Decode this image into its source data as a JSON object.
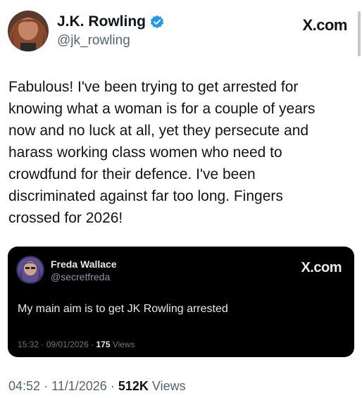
{
  "header": {
    "display_name": "J.K. Rowling",
    "handle": "@jk_rowling",
    "brand": "X.com",
    "verified_icon": "verified-badge-icon",
    "avatar_icon": "profile-photo"
  },
  "tweet": {
    "text": "Fabulous! I've been trying to get arrested for\nknowing what a woman is for a couple of years\nnow and no luck at all, yet they persecute and\nharass working class women who need to\ncrowdfund for their defence. I've been\ndiscriminated against far too long. Fingers\ncrossed for 2026!",
    "time": "04:52",
    "date": "11/1/2026",
    "views_count": "512K",
    "views_label": "Views",
    "separator": "·"
  },
  "quote": {
    "display_name": "Freda Wallace",
    "handle": "@secretfreda",
    "brand": "X.com",
    "text": "My main aim is to get JK Rowling arrested",
    "time": "15:32",
    "date": "09/01/2026",
    "views_count": "175",
    "views_label": "Views",
    "separator": "·",
    "avatar_icon": "profile-photo"
  },
  "colors": {
    "verified": "#1d9bf0",
    "text_primary": "#0f1419",
    "text_secondary": "#536471",
    "quote_background": "#000000"
  }
}
